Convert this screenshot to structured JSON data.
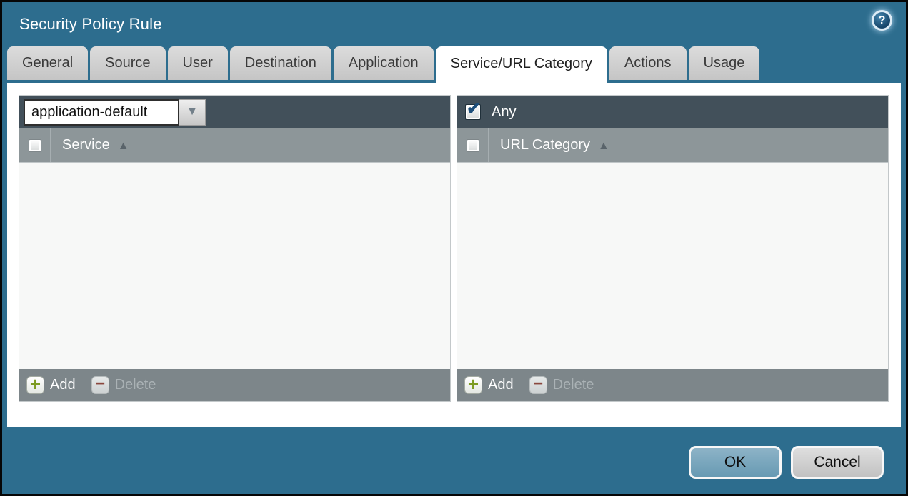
{
  "window_title": "Security Policy Rule",
  "icons": {
    "help": "?",
    "dropdown_arrow": "▼",
    "sort_asc": "▲",
    "check": "✔",
    "add": "+",
    "delete": "−"
  },
  "tabs": [
    {
      "label": "General",
      "active": false
    },
    {
      "label": "Source",
      "active": false
    },
    {
      "label": "User",
      "active": false
    },
    {
      "label": "Destination",
      "active": false
    },
    {
      "label": "Application",
      "active": false
    },
    {
      "label": "Service/URL Category",
      "active": true
    },
    {
      "label": "Actions",
      "active": false
    },
    {
      "label": "Usage",
      "active": false
    }
  ],
  "service_panel": {
    "dropdown_value": "application-default",
    "column_header": "Service",
    "rows": [],
    "add_label": "Add",
    "delete_label": "Delete",
    "delete_enabled": false
  },
  "url_category_panel": {
    "any_label": "Any",
    "any_checked": true,
    "column_header": "URL Category",
    "rows": [],
    "add_label": "Add",
    "delete_label": "Delete",
    "delete_enabled": false
  },
  "action_buttons": {
    "ok": "OK",
    "cancel": "Cancel"
  },
  "colors": {
    "titlebar_bg": "#2d6d8e",
    "panel_topbar_bg": "#42505a",
    "panel_header_bg": "#8d9699",
    "panel_footer_bg": "#7d868a",
    "panel_body_bg": "#f7f8f7",
    "ok_button_bg": "#6f9fb8",
    "cancel_button_bg": "#cfcfcf",
    "add_plus": "#7c9b22",
    "delete_minus": "#8a473e",
    "checkmark": "#1d4e7a"
  }
}
